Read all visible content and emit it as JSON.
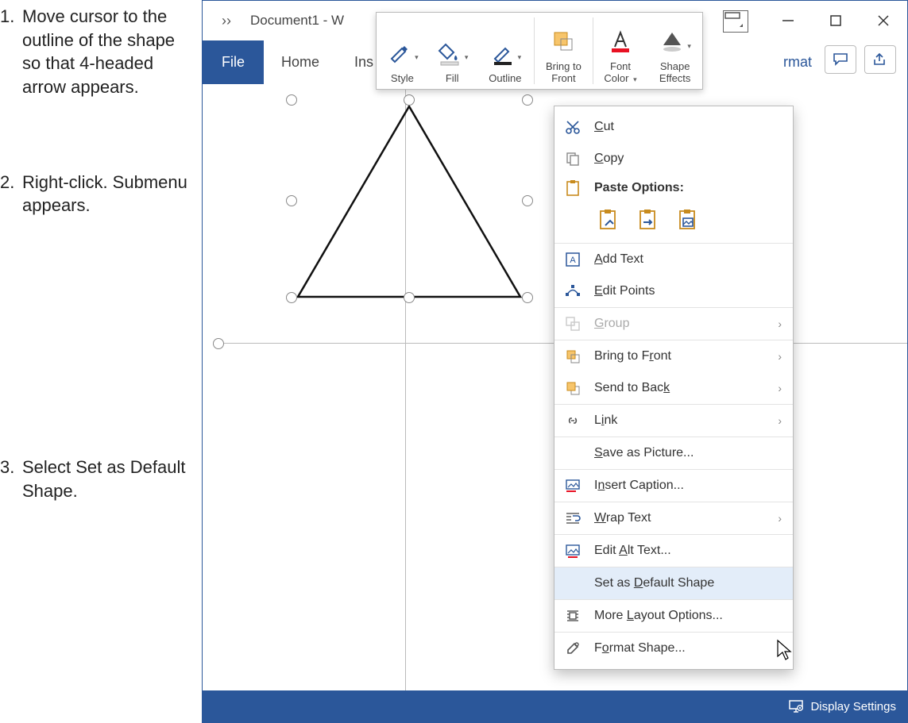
{
  "instructions": {
    "step1_num": "1.",
    "step1_text": "Move cursor to the outline of the shape so that 4-headed arrow appears.",
    "step2_num": "2.",
    "step2_text": "Right-click. Submenu appears.",
    "step3_num": "3.",
    "step3_text": "Select Set as Default Shape."
  },
  "titlebar": {
    "chevron": "››",
    "title": "Document1  -  W"
  },
  "window_controls": {
    "minimize": "minimize",
    "restore": "restore",
    "close": "close"
  },
  "tabs": {
    "file": "File",
    "home": "Home",
    "insert_partial": "Ins",
    "right_partial": "rmat"
  },
  "mini_ribbon": {
    "style": "Style",
    "fill": "Fill",
    "outline": "Outline",
    "bring_front_l1": "Bring to",
    "bring_front_l2": "Front",
    "font_color_l1": "Font",
    "font_color_l2": "Color",
    "shape_effects_l1": "Shape",
    "shape_effects_l2": "Effects"
  },
  "context_menu": {
    "cut": "Cut",
    "copy": "Copy",
    "paste_options_label": "Paste Options:",
    "add_text": "Add Text",
    "edit_points": "Edit Points",
    "group": "Group",
    "bring_front": "Bring to Front",
    "send_back": "Send to Back",
    "link": "Link",
    "save_picture": "Save as Picture...",
    "insert_caption": "Insert Caption...",
    "wrap_text": "Wrap Text",
    "edit_alt": "Edit Alt Text...",
    "set_default": "Set as Default Shape",
    "more_layout": "More Layout Options...",
    "format_shape": "Format Shape..."
  },
  "statusbar": {
    "display_settings": "Display Settings"
  }
}
